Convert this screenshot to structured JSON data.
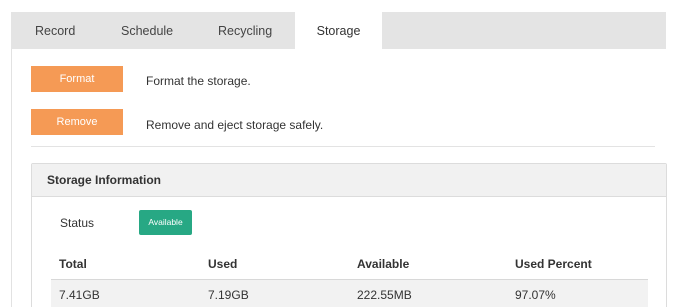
{
  "tabs": [
    {
      "label": "Record"
    },
    {
      "label": "Schedule"
    },
    {
      "label": "Recycling"
    },
    {
      "label": "Storage",
      "active": true
    }
  ],
  "actions": {
    "format": {
      "label": "Format",
      "description": "Format the storage."
    },
    "remove": {
      "label": "Remove",
      "description": "Remove and eject storage safely."
    }
  },
  "storage_info": {
    "title": "Storage Information",
    "status_label": "Status",
    "status_value": "Available",
    "columns": [
      "Total",
      "Used",
      "Available",
      "Used Percent"
    ],
    "row": [
      "7.41GB",
      "7.19GB",
      "222.55MB",
      "97.07%"
    ]
  },
  "colors": {
    "accent_button": "#f59a55",
    "status_available": "#27a884",
    "tabbar_bg": "#e4e4e4"
  }
}
